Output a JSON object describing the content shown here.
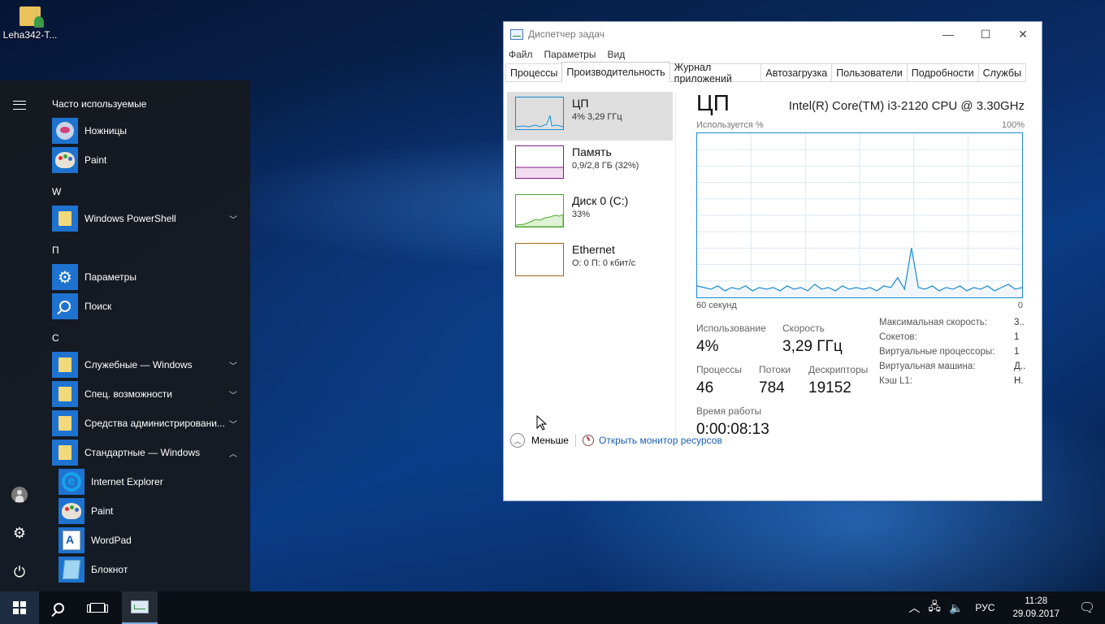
{
  "desktop": {
    "icon_label": "Leha342-T..."
  },
  "start_menu": {
    "header": "Часто используемые",
    "frequent": [
      {
        "label": "Ножницы",
        "icon": "scissors-icon"
      },
      {
        "label": "Paint",
        "icon": "paint-icon"
      }
    ],
    "section_w": "W",
    "powershell": "Windows PowerShell",
    "section_p": "П",
    "settings": "Параметры",
    "search": "Поиск",
    "section_s": "С",
    "folders": [
      "Служебные — Windows",
      "Спец. возможности",
      "Средства администрировани...",
      "Стандартные — Windows"
    ],
    "standard_apps": [
      "Internet Explorer",
      "Paint",
      "WordPad",
      "Блокнот"
    ]
  },
  "task_manager": {
    "title": "Диспетчер задач",
    "menu": [
      "Файл",
      "Параметры",
      "Вид"
    ],
    "tabs": [
      "Процессы",
      "Производительность",
      "Журнал приложений",
      "Автозагрузка",
      "Пользователи",
      "Подробности",
      "Службы"
    ],
    "active_tab": "Производительность",
    "resources": [
      {
        "name": "ЦП",
        "value": "4% 3,29 ГГц",
        "color": "#1a8ad0"
      },
      {
        "name": "Память",
        "value": "0,9/2,8 ГБ (32%)",
        "color": "#8b1a8b"
      },
      {
        "name": "Диск 0 (C:)",
        "value": "33%",
        "color": "#4aa82a"
      },
      {
        "name": "Ethernet",
        "value": "О: 0 П: 0 кбит/с",
        "color": "#a0661a"
      }
    ],
    "main": {
      "title": "ЦП",
      "cpu_name": "Intel(R) Core(TM) i3-2120 CPU @ 3.30GHz",
      "usage_label": "Используется %",
      "max_label": "100%",
      "time_label": "60 секунд",
      "min_label": "0",
      "usage_k": "Использование",
      "usage_v": "4%",
      "speed_k": "Скорость",
      "speed_v": "3,29 ГГц",
      "proc_k": "Процессы",
      "proc_v": "46",
      "threads_k": "Потоки",
      "threads_v": "784",
      "handles_k": "Дескрипторы",
      "handles_v": "19152",
      "uptime_k": "Время работы",
      "uptime_v": "0:00:08:13",
      "specs": [
        {
          "k": "Максимальная скорость:",
          "v": "3.."
        },
        {
          "k": "Сокетов:",
          "v": "1"
        },
        {
          "k": "Виртуальные процессоры:",
          "v": "1"
        },
        {
          "k": "Виртуальная машина:",
          "v": "Д.."
        },
        {
          "k": "Кэш L1:",
          "v": "Н."
        }
      ]
    },
    "footer": {
      "less": "Меньше",
      "monitor": "Открыть монитор ресурсов"
    }
  },
  "chart_data": {
    "type": "area",
    "ylim": [
      0,
      100
    ],
    "y": [
      7,
      6,
      5,
      7,
      4,
      6,
      5,
      7,
      4,
      6,
      5,
      6,
      4,
      7,
      5,
      6,
      4,
      8,
      5,
      6,
      4,
      7,
      5,
      6,
      5,
      6,
      4,
      7,
      6,
      12,
      5,
      30,
      6,
      5,
      7,
      4,
      6,
      5,
      7,
      4,
      6,
      5,
      7,
      4,
      6,
      8,
      5,
      6
    ]
  },
  "taskbar": {
    "time": "11:28",
    "date": "29.09.2017",
    "lang": "РУС"
  }
}
